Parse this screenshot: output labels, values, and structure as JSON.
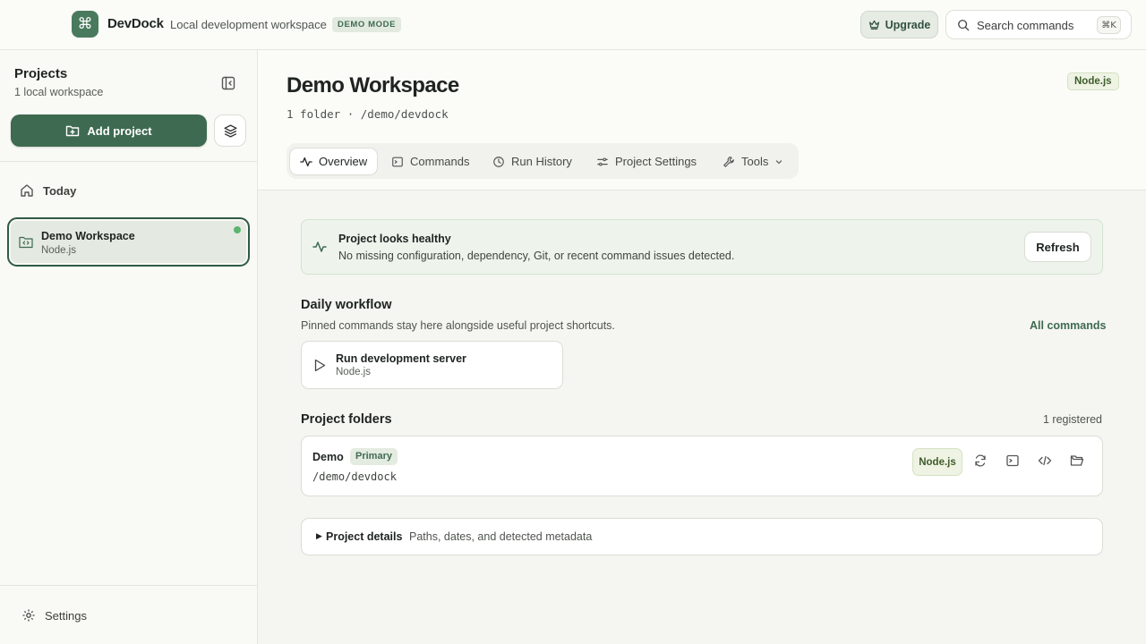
{
  "app": {
    "name": "DevDock",
    "subtitle": "Local development workspace",
    "mode_badge": "DEMO MODE",
    "logo_glyph": "⌘"
  },
  "header": {
    "upgrade_label": "Upgrade",
    "search_placeholder": "Search commands",
    "search_shortcut": "⌘K"
  },
  "sidebar": {
    "title": "Projects",
    "subtitle": "1 local workspace",
    "add_project_label": "Add project",
    "today_label": "Today",
    "projects": [
      {
        "name": "Demo Workspace",
        "type": "Node.js",
        "status_color": "#5cb46e"
      }
    ],
    "settings_label": "Settings"
  },
  "workspace": {
    "title": "Demo Workspace",
    "path_line": "1 folder · /demo/devdock",
    "runtime_badge": "Node.js"
  },
  "tabs": [
    {
      "label": "Overview",
      "icon": "activity-icon",
      "active": true
    },
    {
      "label": "Commands",
      "icon": "terminal-icon",
      "active": false
    },
    {
      "label": "Run History",
      "icon": "clock-icon",
      "active": false
    },
    {
      "label": "Project Settings",
      "icon": "sliders-icon",
      "active": false
    },
    {
      "label": "Tools",
      "icon": "wrench-icon",
      "active": false
    }
  ],
  "health": {
    "title": "Project looks healthy",
    "message": "No missing configuration, dependency, Git, or recent command issues detected.",
    "refresh_label": "Refresh"
  },
  "workflow": {
    "title": "Daily workflow",
    "subtitle": "Pinned commands stay here alongside useful project shortcuts.",
    "all_commands_label": "All commands",
    "commands": [
      {
        "name": "Run development server",
        "type": "Node.js"
      }
    ]
  },
  "folders": {
    "title": "Project folders",
    "count_label": "1 registered",
    "items": [
      {
        "name": "Demo",
        "badge": "Primary",
        "path": "/demo/devdock",
        "runtime": "Node.js"
      }
    ]
  },
  "details": {
    "title": "Project details",
    "subtitle": "Paths, dates, and detected metadata"
  },
  "colors": {
    "accent": "#3e6a51",
    "logo": "#4a7a5e",
    "healthy": "#5cb46e",
    "background": "#f5f5f1"
  }
}
